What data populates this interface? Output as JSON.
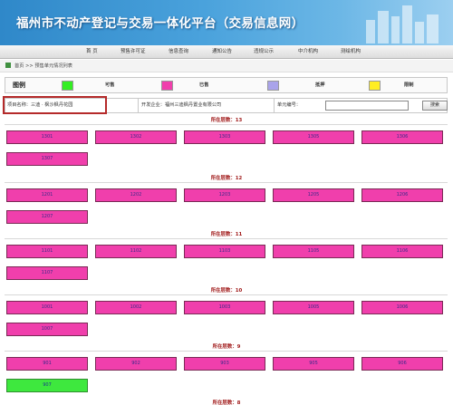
{
  "header": {
    "title": "福州市不动产登记与交易一体化平台（交易信息网）"
  },
  "nav": [
    {
      "label": "首 页"
    },
    {
      "label": "预售许可证"
    },
    {
      "label": "信息查询"
    },
    {
      "label": "通知公告"
    },
    {
      "label": "违规公示"
    },
    {
      "label": "中介机构"
    },
    {
      "label": "测绘机构"
    }
  ],
  "breadcrumb": {
    "home": "首页",
    "sep": ">>",
    "current": "预售单元情况列表"
  },
  "legend": {
    "title": "图例",
    "items": [
      {
        "label": "可售",
        "color": "#33ee22"
      },
      {
        "label": "已售",
        "color": "#f03fac"
      },
      {
        "label": "抵押",
        "color": "#a9a3ea"
      },
      {
        "label": "限制",
        "color": "#ffee22"
      }
    ]
  },
  "filter": {
    "project": "项目名称：三迪 · 枫沙枫丹花园",
    "developer": "开发企业：福州三迪枫丹置业有限公司",
    "unit_label": "单元编号：",
    "unit_value": "",
    "search_button": "搜索"
  },
  "floors": [
    {
      "title": "所在层数：13",
      "units": [
        {
          "label": "1301",
          "status": "sold"
        },
        {
          "label": "1302",
          "status": "sold"
        },
        {
          "label": "1303",
          "status": "sold"
        },
        {
          "label": "1305",
          "status": "sold"
        },
        {
          "label": "1306",
          "status": "sold"
        },
        {
          "label": "1307",
          "status": "sold"
        }
      ]
    },
    {
      "title": "所在层数：12",
      "units": [
        {
          "label": "1201",
          "status": "sold"
        },
        {
          "label": "1202",
          "status": "sold"
        },
        {
          "label": "1203",
          "status": "sold"
        },
        {
          "label": "1205",
          "status": "sold"
        },
        {
          "label": "1206",
          "status": "sold"
        },
        {
          "label": "1207",
          "status": "sold"
        }
      ]
    },
    {
      "title": "所在层数：11",
      "units": [
        {
          "label": "1101",
          "status": "sold"
        },
        {
          "label": "1102",
          "status": "sold"
        },
        {
          "label": "1103",
          "status": "sold"
        },
        {
          "label": "1105",
          "status": "sold"
        },
        {
          "label": "1106",
          "status": "sold"
        },
        {
          "label": "1107",
          "status": "sold"
        }
      ]
    },
    {
      "title": "所在层数：10",
      "units": [
        {
          "label": "1001",
          "status": "sold"
        },
        {
          "label": "1002",
          "status": "sold"
        },
        {
          "label": "1003",
          "status": "sold"
        },
        {
          "label": "1005",
          "status": "sold"
        },
        {
          "label": "1006",
          "status": "sold"
        },
        {
          "label": "1007",
          "status": "sold"
        }
      ]
    },
    {
      "title": "所在层数：9",
      "units": [
        {
          "label": "901",
          "status": "sold"
        },
        {
          "label": "902",
          "status": "sold"
        },
        {
          "label": "903",
          "status": "sold"
        },
        {
          "label": "905",
          "status": "sold"
        },
        {
          "label": "906",
          "status": "sold"
        },
        {
          "label": "907",
          "status": "available"
        }
      ]
    },
    {
      "title": "所在层数：8",
      "units": []
    }
  ]
}
